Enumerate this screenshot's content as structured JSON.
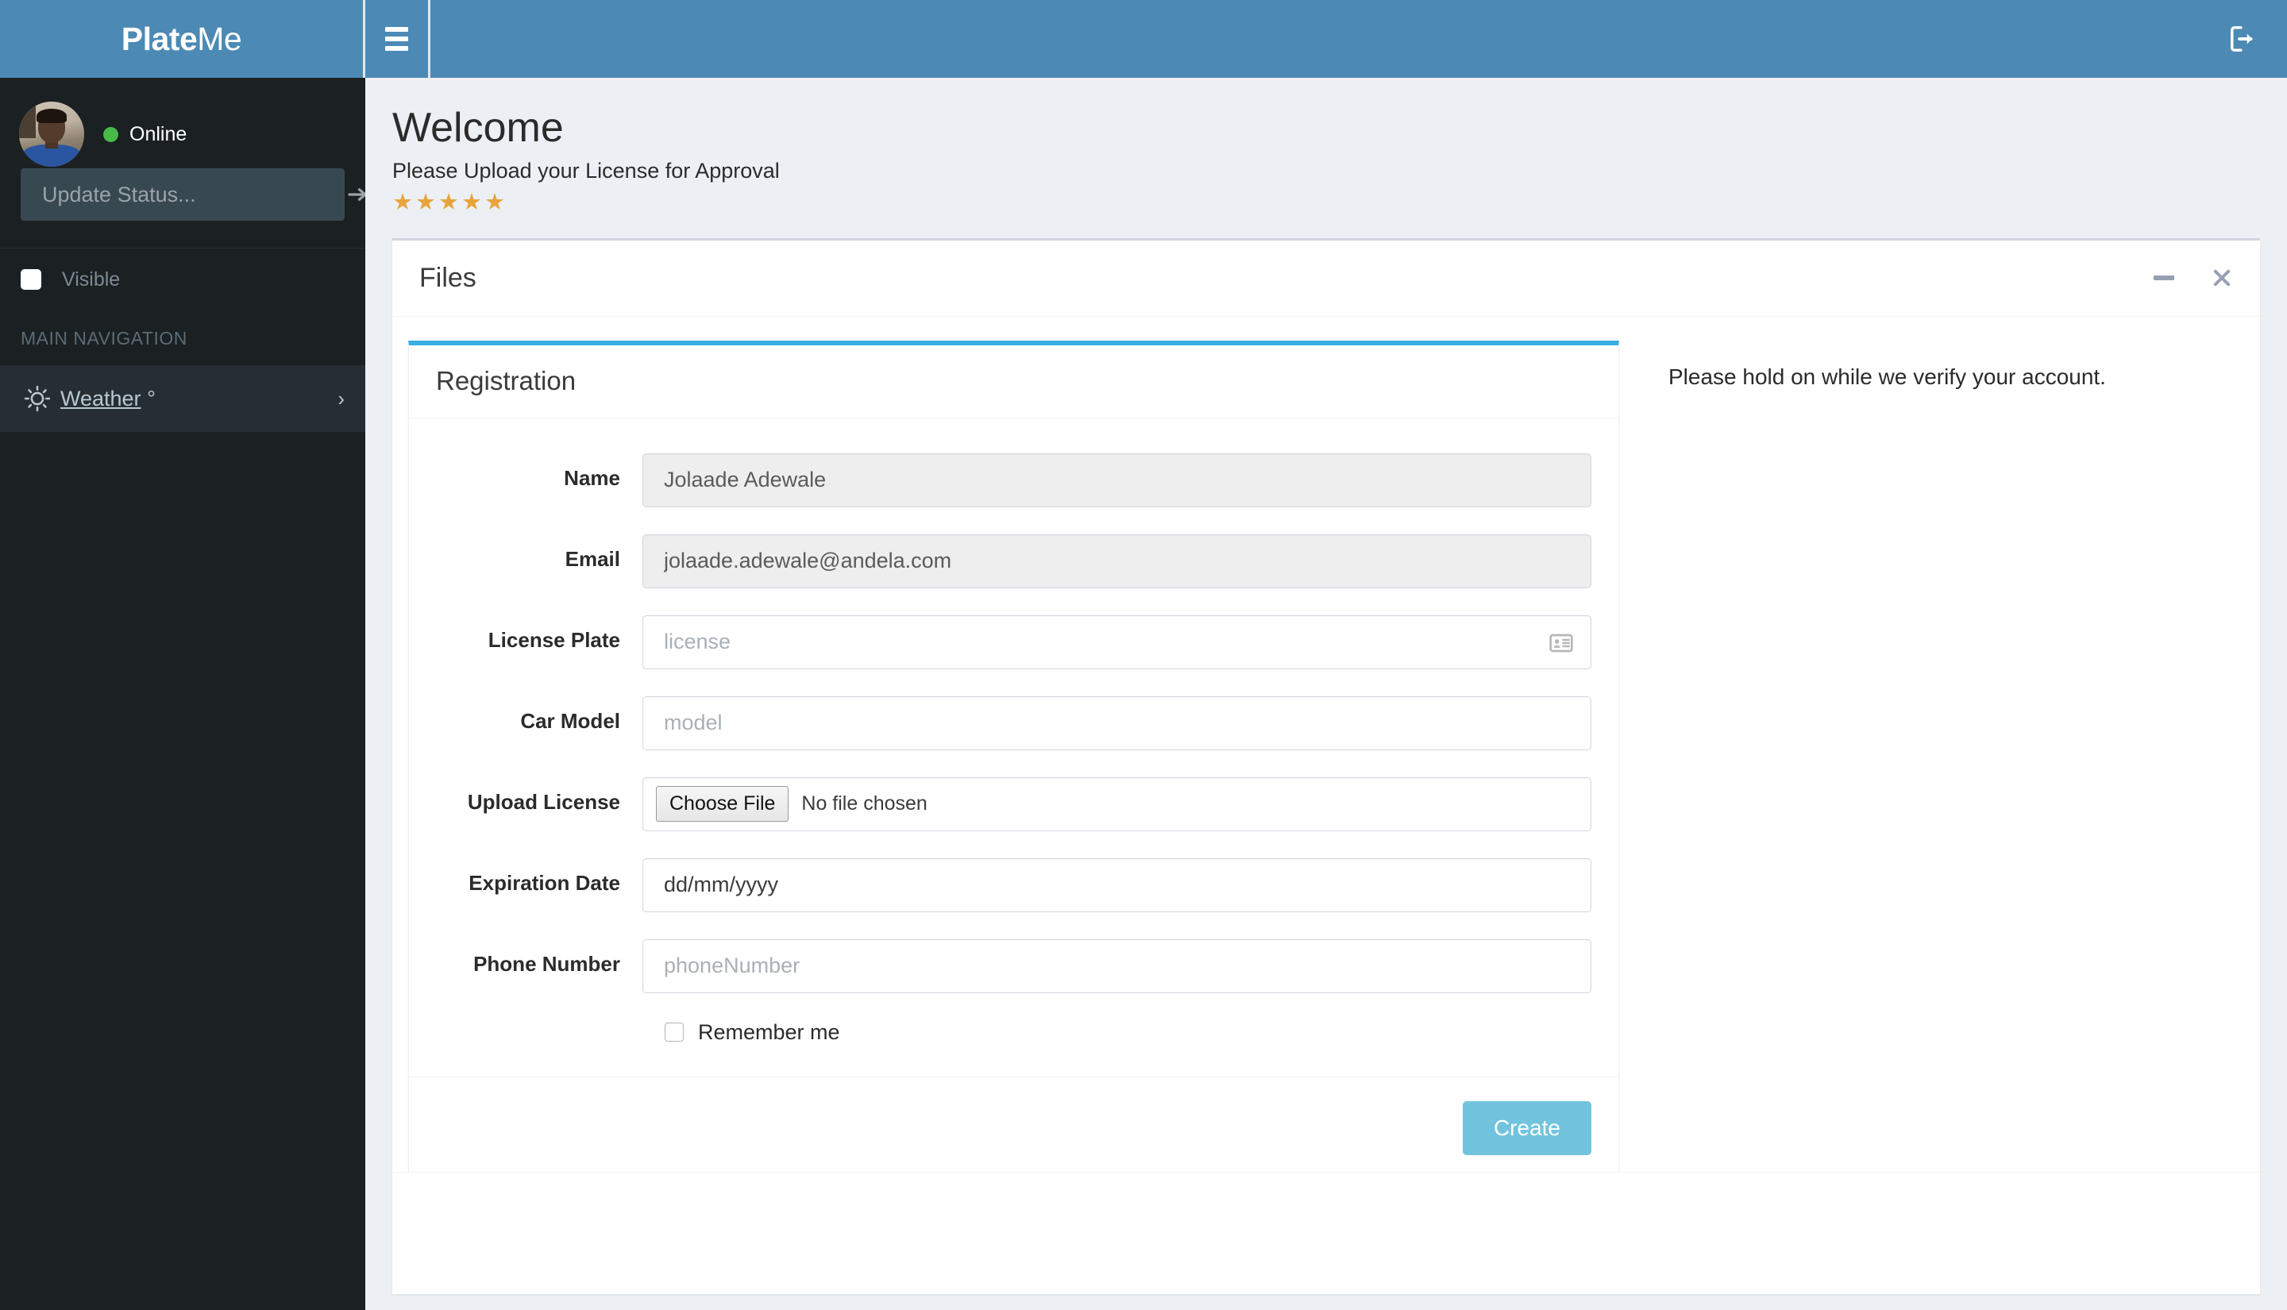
{
  "navbar": {
    "logo_bold": "Plate",
    "logo_light": "Me",
    "toggle_icon": "hamburger-icon",
    "logout_icon": "sign-out-icon"
  },
  "sidebar": {
    "user": {
      "status_label": "Online",
      "status_color": "#49b949",
      "avatar_icon": "user-avatar-photo"
    },
    "status_form": {
      "placeholder": "Update Status...",
      "value": "",
      "submit_icon": "arrow-right-icon"
    },
    "visible_toggle": {
      "label": "Visible",
      "checked": false
    },
    "nav_header": "MAIN NAVIGATION",
    "items": [
      {
        "label": "Weather",
        "suffix": "°",
        "icon": "sun-icon",
        "chevron": "chevron-right-icon"
      }
    ]
  },
  "main": {
    "title": "Welcome",
    "subtitle": "Please Upload your License for Approval",
    "rating": {
      "stars_filled": 5,
      "star_glyph": "★",
      "color": "#e8a33d"
    },
    "box": {
      "title": "Files",
      "collapse_icon": "minus-icon",
      "close_icon": "close-icon",
      "verify_message": "Please hold on while we verify your account.",
      "accent_color": "#3cafe0"
    },
    "form": {
      "title": "Registration",
      "fields": [
        {
          "label": "Name",
          "value": "Jolaade Adewale",
          "placeholder": "",
          "disabled": true,
          "icon": ""
        },
        {
          "label": "Email",
          "value": "jolaade.adewale@andela.com",
          "placeholder": "",
          "disabled": true,
          "icon": ""
        },
        {
          "label": "License Plate",
          "value": "",
          "placeholder": "license",
          "disabled": false,
          "icon": "vcard-icon"
        },
        {
          "label": "Car Model",
          "value": "",
          "placeholder": "model",
          "disabled": false,
          "icon": ""
        }
      ],
      "upload": {
        "label": "Upload License",
        "button_label": "Choose File",
        "file_status": "No file chosen"
      },
      "expiration": {
        "label": "Expiration Date",
        "value": "dd/mm/yyyy"
      },
      "phone": {
        "label": "Phone Number",
        "value": "",
        "placeholder": "phoneNumber"
      },
      "remember": {
        "label": "Remember me",
        "checked": false
      },
      "submit_label": "Create"
    }
  }
}
